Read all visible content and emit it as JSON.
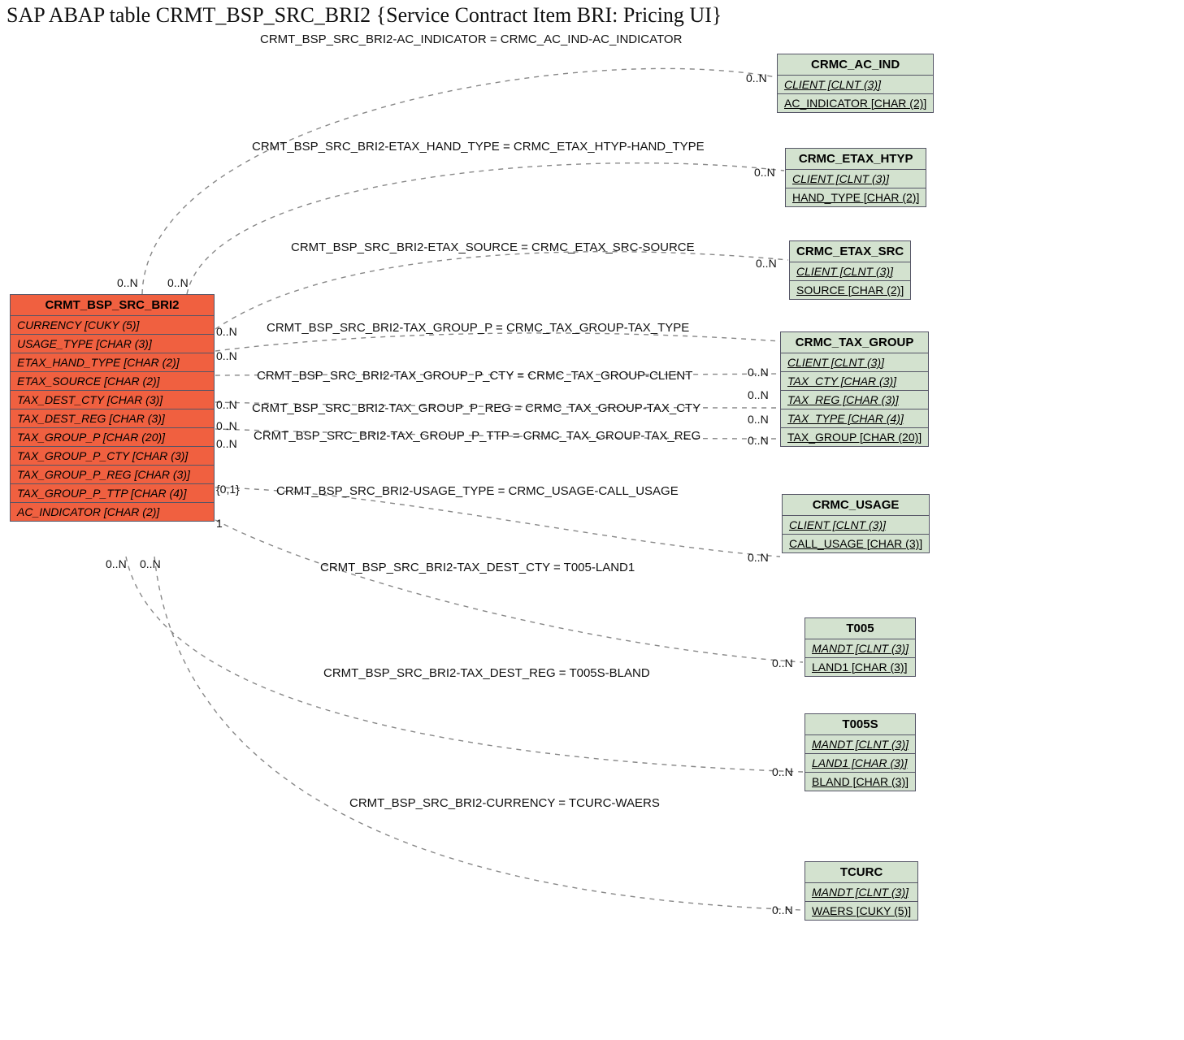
{
  "title": "SAP ABAP table CRMT_BSP_SRC_BRI2 {Service Contract Item BRI: Pricing UI}",
  "main": {
    "name": "CRMT_BSP_SRC_BRI2",
    "fields": [
      "CURRENCY [CUKY (5)]",
      "USAGE_TYPE [CHAR (3)]",
      "ETAX_HAND_TYPE [CHAR (2)]",
      "ETAX_SOURCE [CHAR (2)]",
      "TAX_DEST_CTY [CHAR (3)]",
      "TAX_DEST_REG [CHAR (3)]",
      "TAX_GROUP_P [CHAR (20)]",
      "TAX_GROUP_P_CTY [CHAR (3)]",
      "TAX_GROUP_P_REG [CHAR (3)]",
      "TAX_GROUP_P_TTP [CHAR (4)]",
      "AC_INDICATOR [CHAR (2)]"
    ]
  },
  "refs": {
    "ac_ind": {
      "name": "CRMC_AC_IND",
      "rows": [
        {
          "t": "CLIENT [CLNT (3)]",
          "u": true,
          "i": true
        },
        {
          "t": "AC_INDICATOR [CHAR (2)]",
          "u": true
        }
      ]
    },
    "etax_htyp": {
      "name": "CRMC_ETAX_HTYP",
      "rows": [
        {
          "t": "CLIENT [CLNT (3)]",
          "u": true,
          "i": true
        },
        {
          "t": "HAND_TYPE [CHAR (2)]",
          "u": true
        }
      ]
    },
    "etax_src": {
      "name": "CRMC_ETAX_SRC",
      "rows": [
        {
          "t": "CLIENT [CLNT (3)]",
          "u": true,
          "i": true
        },
        {
          "t": "SOURCE [CHAR (2)]",
          "u": true
        }
      ]
    },
    "tax_group": {
      "name": "CRMC_TAX_GROUP",
      "rows": [
        {
          "t": "CLIENT [CLNT (3)]",
          "u": true,
          "i": true
        },
        {
          "t": "TAX_CTY [CHAR (3)]",
          "u": true,
          "i": true
        },
        {
          "t": "TAX_REG [CHAR (3)]",
          "u": true,
          "i": true
        },
        {
          "t": "TAX_TYPE [CHAR (4)]",
          "u": true,
          "i": true
        },
        {
          "t": "TAX_GROUP [CHAR (20)]",
          "u": true
        }
      ]
    },
    "usage": {
      "name": "CRMC_USAGE",
      "rows": [
        {
          "t": "CLIENT [CLNT (3)]",
          "u": true,
          "i": true
        },
        {
          "t": "CALL_USAGE [CHAR (3)]",
          "u": true
        }
      ]
    },
    "t005": {
      "name": "T005",
      "rows": [
        {
          "t": "MANDT [CLNT (3)]",
          "u": true,
          "i": true
        },
        {
          "t": "LAND1 [CHAR (3)]",
          "u": true
        }
      ]
    },
    "t005s": {
      "name": "T005S",
      "rows": [
        {
          "t": "MANDT [CLNT (3)]",
          "u": true,
          "i": true
        },
        {
          "t": "LAND1 [CHAR (3)]",
          "u": true,
          "i": true
        },
        {
          "t": "BLAND [CHAR (3)]",
          "u": true
        }
      ]
    },
    "tcurc": {
      "name": "TCURC",
      "rows": [
        {
          "t": "MANDT [CLNT (3)]",
          "u": true,
          "i": true
        },
        {
          "t": "WAERS [CUKY (5)]",
          "u": true
        }
      ]
    }
  },
  "rels": {
    "r1": "CRMT_BSP_SRC_BRI2-AC_INDICATOR = CRMC_AC_IND-AC_INDICATOR",
    "r2": "CRMT_BSP_SRC_BRI2-ETAX_HAND_TYPE = CRMC_ETAX_HTYP-HAND_TYPE",
    "r3": "CRMT_BSP_SRC_BRI2-ETAX_SOURCE = CRMC_ETAX_SRC-SOURCE",
    "r4": "CRMT_BSP_SRC_BRI2-TAX_GROUP_P = CRMC_TAX_GROUP-TAX_TYPE",
    "r5": "CRMT_BSP_SRC_BRI2-TAX_GROUP_P_CTY = CRMC_TAX_GROUP-CLIENT",
    "r6": "CRMT_BSP_SRC_BRI2-TAX_GROUP_P_REG = CRMC_TAX_GROUP-TAX_CTY",
    "r7": "CRMT_BSP_SRC_BRI2-TAX_GROUP_P_TTP = CRMC_TAX_GROUP-TAX_REG",
    "r8": "CRMT_BSP_SRC_BRI2-USAGE_TYPE = CRMC_USAGE-CALL_USAGE",
    "r9": "CRMT_BSP_SRC_BRI2-TAX_DEST_CTY = T005-LAND1",
    "r10": "CRMT_BSP_SRC_BRI2-TAX_DEST_REG = T005S-BLAND",
    "r11": "CRMT_BSP_SRC_BRI2-CURRENCY = TCURC-WAERS"
  },
  "cards": {
    "n0N": "0..N",
    "one": "1",
    "opt": "{0,1}"
  }
}
